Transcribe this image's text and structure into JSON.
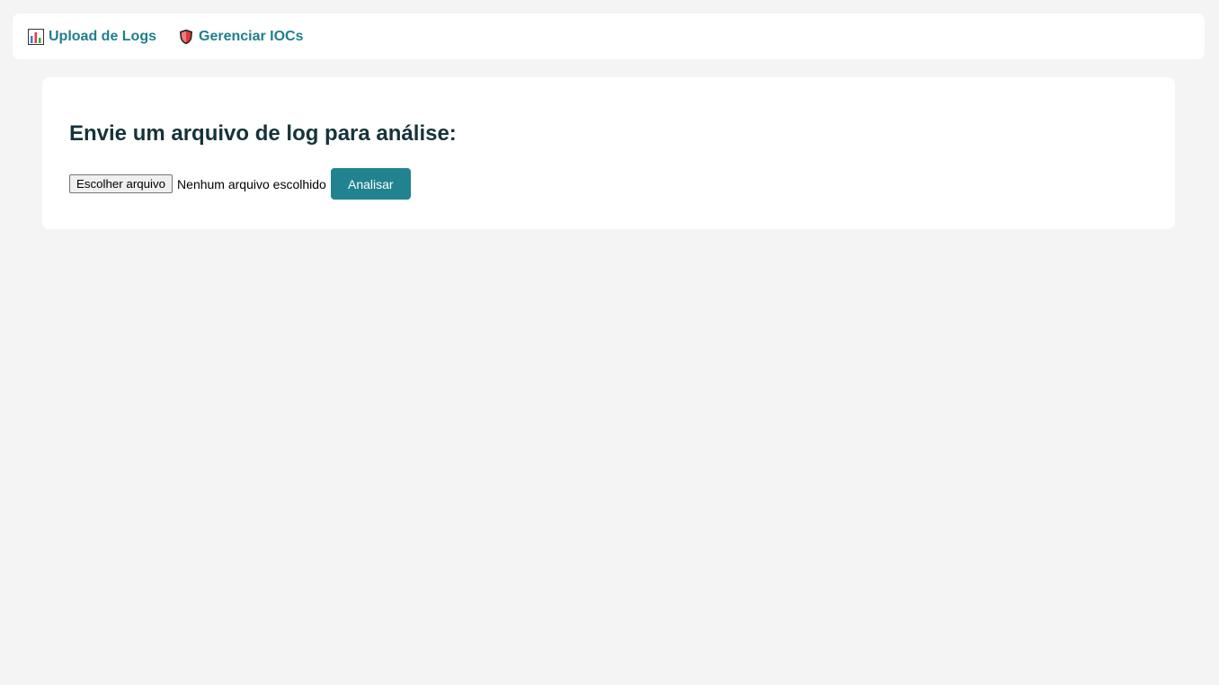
{
  "nav": {
    "items": [
      {
        "label": "Upload de Logs",
        "icon": "bar-chart-icon"
      },
      {
        "label": "Gerenciar IOCs",
        "icon": "shield-icon"
      }
    ]
  },
  "upload": {
    "heading": "Envie um arquivo de log para análise:",
    "choose_file_label": "Escolher arquivo",
    "file_status": "Nenhum arquivo escolhido",
    "submit_label": "Analisar"
  },
  "colors": {
    "accent": "#21838f",
    "link": "#1f7f8c",
    "heading": "#17333a",
    "background": "#f4f4f4"
  }
}
